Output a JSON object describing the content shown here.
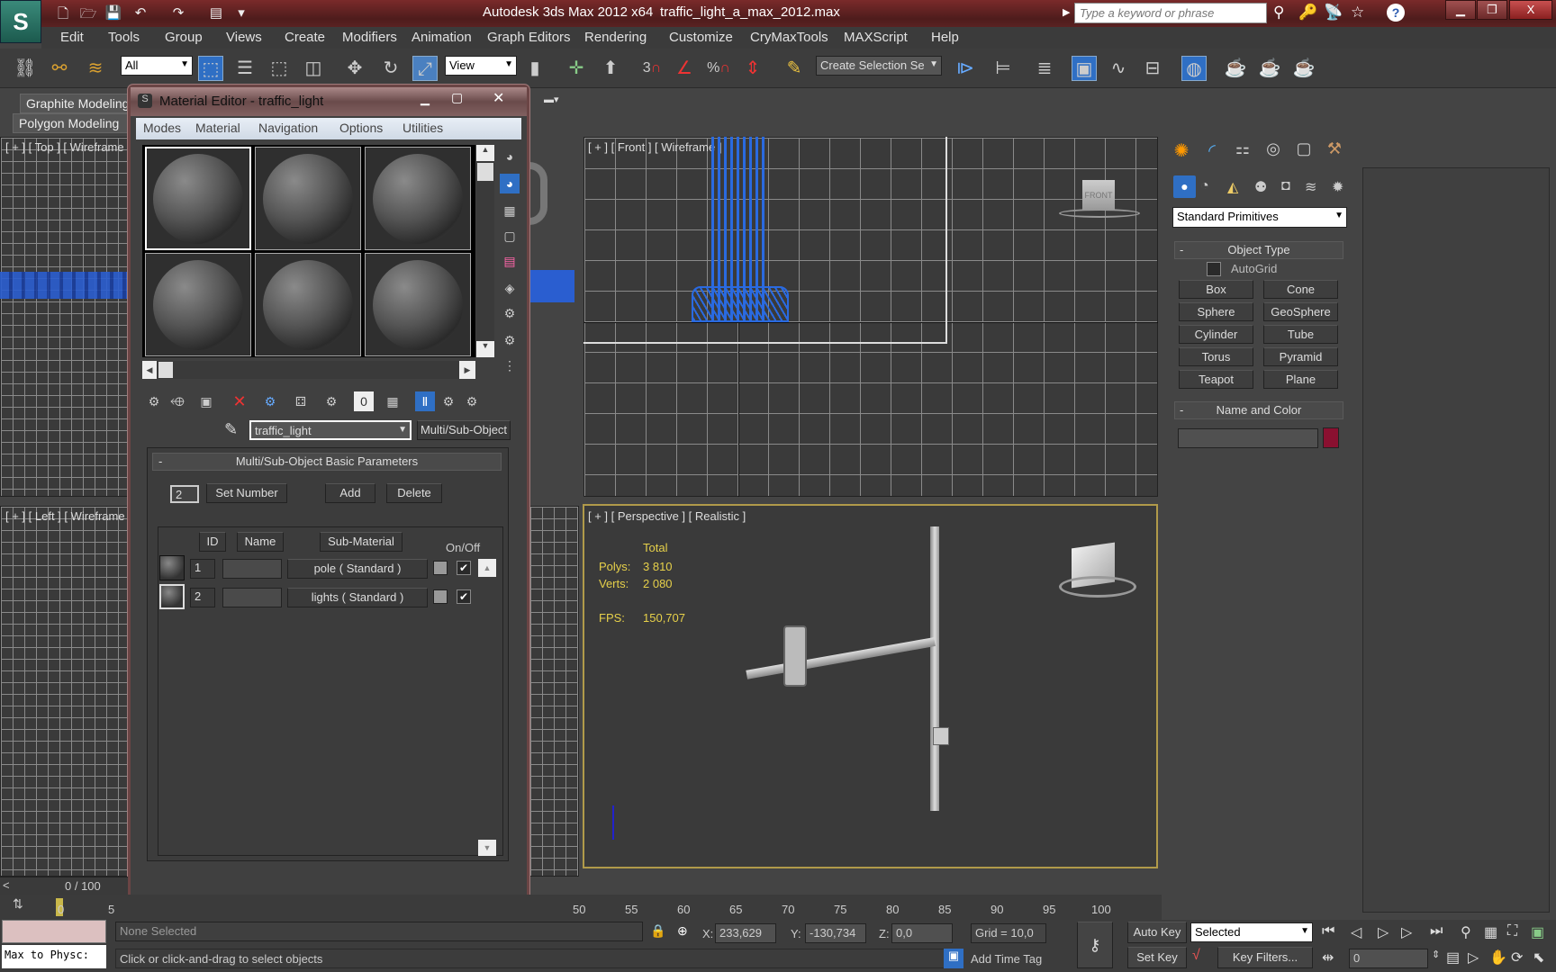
{
  "titlebar": {
    "app_title": "Autodesk 3ds Max  2012 x64",
    "file_name": "traffic_light_a_max_2012.max",
    "search_placeholder": "Type a keyword or phrase",
    "quick_access": [
      "new-icon",
      "open-icon",
      "save-icon",
      "undo-icon",
      "redo-icon",
      "project-folder-icon",
      "customize-icon"
    ],
    "right_icons": [
      "binoculars-icon",
      "key-icon",
      "satellite-icon",
      "star-icon",
      "help-icon"
    ],
    "window_buttons": {
      "minimize": "▁",
      "restore": "❐",
      "close": "X"
    }
  },
  "menu": [
    "Edit",
    "Tools",
    "Group",
    "Views",
    "Create",
    "Modifiers",
    "Animation",
    "Graph Editors",
    "Rendering",
    "Customize",
    "CryMaxTools",
    "MAXScript",
    "Help"
  ],
  "toolbar": {
    "selection_filter": "All",
    "ref_coord": "View",
    "selection_set": "Create Selection Se",
    "snap_labels": [
      "3",
      "",
      "%",
      ""
    ]
  },
  "ribbon": {
    "tab1": "Graphite Modeling",
    "tab2": "Polygon Modeling"
  },
  "viewports": {
    "top": "[ + ] [ Top ] [ Wireframe ]",
    "front": "[ + ] [ Front ] [ Wireframe ]",
    "left": "[ + ] [ Left ] [ Wireframe ]",
    "perspective": "[ + ] [ Perspective ] [ Realistic ]",
    "viewcube_front": "FRONT"
  },
  "stats": {
    "header": "Total",
    "polys_label": "Polys:",
    "polys": "3 810",
    "verts_label": "Verts:",
    "verts": "2 080",
    "fps_label": "FPS:",
    "fps": "150,707"
  },
  "material_editor": {
    "title": "Material Editor - traffic_light",
    "menu": [
      "Modes",
      "Material",
      "Navigation",
      "Options",
      "Utilities"
    ],
    "material_name": "traffic_light",
    "material_type": "Multi/Sub-Object",
    "rollout_title": "Multi/Sub-Object Basic Parameters",
    "collapse": "-",
    "count": "2",
    "set_number": "Set Number",
    "add": "Add",
    "delete": "Delete",
    "columns": {
      "id": "ID",
      "name": "Name",
      "sub": "Sub-Material",
      "onoff": "On/Off"
    },
    "rows": [
      {
        "id": "1",
        "name": "",
        "sub": "pole  ( Standard )",
        "on": "✔"
      },
      {
        "id": "2",
        "name": "",
        "sub": "lights  ( Standard )",
        "on": "✔"
      }
    ]
  },
  "command_panel": {
    "tabs": [
      "create-icon",
      "modify-icon",
      "hierarchy-icon",
      "motion-icon",
      "display-icon",
      "utilities-icon"
    ],
    "category": "Standard Primitives",
    "object_type_title": "Object Type",
    "autogrid": "AutoGrid",
    "buttons": [
      "Box",
      "Cone",
      "Sphere",
      "GeoSphere",
      "Cylinder",
      "Tube",
      "Torus",
      "Pyramid",
      "Teapot",
      "Plane"
    ],
    "name_color_title": "Name and Color",
    "object_name": "",
    "object_color": "#8a1030"
  },
  "timeline": {
    "frame": "0 / 100",
    "ticks": [
      "0",
      "5",
      "50",
      "55",
      "60",
      "65",
      "70",
      "75",
      "80",
      "85",
      "90",
      "95",
      "100"
    ]
  },
  "status": {
    "maxscript": "Max to Physc:",
    "selection": "None Selected",
    "prompt": "Click or click-and-drag to select objects",
    "x_label": "X:",
    "x": "233,629",
    "y_label": "Y:",
    "y": "-130,734",
    "z_label": "Z:",
    "z": "0,0",
    "grid": "Grid = 10,0",
    "add_time_tag": "Add Time Tag",
    "auto_key": "Auto Key",
    "set_key": "Set Key",
    "key_mode": "Selected",
    "key_filters": "Key Filters...",
    "current_frame": "0"
  }
}
